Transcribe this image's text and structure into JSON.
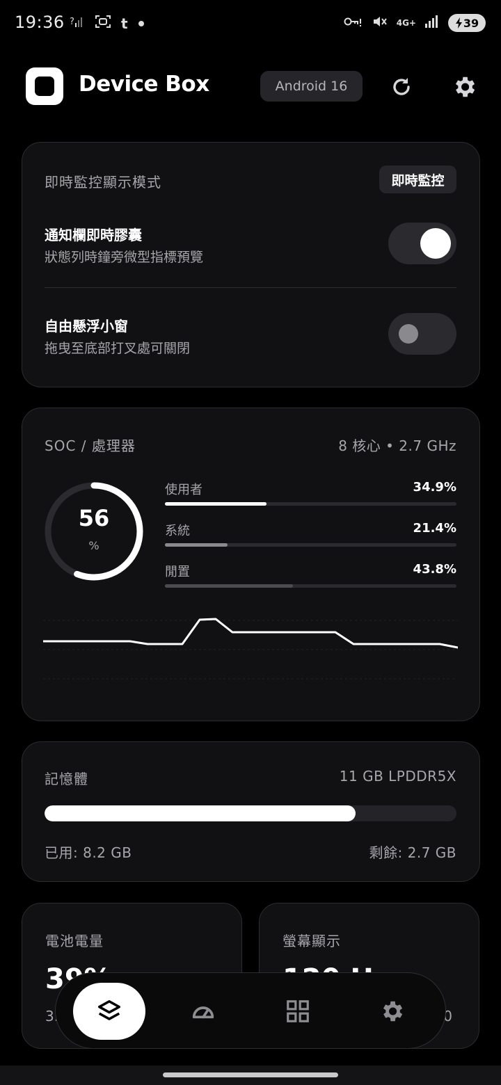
{
  "status_bar": {
    "time": "19:36",
    "left_icons": [
      "signal-question-icon",
      "screenshot-icon",
      "tumblr-icon",
      "dot-icon"
    ],
    "right_icons": [
      "vpn-key-icon",
      "mute-icon",
      "4g-icon",
      "signal-icon"
    ],
    "network": "4G+",
    "battery": "39"
  },
  "header": {
    "title": "Device Box",
    "android_version": "Android 16"
  },
  "monitor_card": {
    "title": "即時監控顯示模式",
    "mode_chip": "即時監控",
    "row1_title": "通知欄即時膠囊",
    "row1_sub": "狀態列時鐘旁微型指標預覽",
    "row1_on": true,
    "row2_title": "自由懸浮小窗",
    "row2_sub": "拖曳至底部打叉處可關閉",
    "row2_on": false
  },
  "soc_card": {
    "title": "SOC / 處理器",
    "meta": "8 核心 • 2.7 GHz",
    "gauge_value": "56",
    "gauge_unit": "%",
    "gauge_fraction": 0.56,
    "bars": [
      {
        "label": "使用者",
        "value": "34.9%",
        "fraction": 0.349
      },
      {
        "label": "系統",
        "value": "21.4%",
        "fraction": 0.214
      },
      {
        "label": "閒置",
        "value": "43.8%",
        "fraction": 0.438
      }
    ]
  },
  "memory_card": {
    "title": "記憶體",
    "meta": "11 GB LPDDR5X",
    "used_fraction": 0.755,
    "used_label": "已用: 8.2 GB",
    "free_label": "剩餘: 2.7 GB"
  },
  "battery_card": {
    "title": "電池電量",
    "value": "39%",
    "sub": "3."
  },
  "display_card": {
    "title": "螢幕顯示",
    "value": "120 Hz",
    "sub": "0"
  },
  "bottom_nav": {
    "items": [
      "layers-icon",
      "speedometer-icon",
      "grid-icon",
      "gear-icon"
    ],
    "active": 0
  }
}
